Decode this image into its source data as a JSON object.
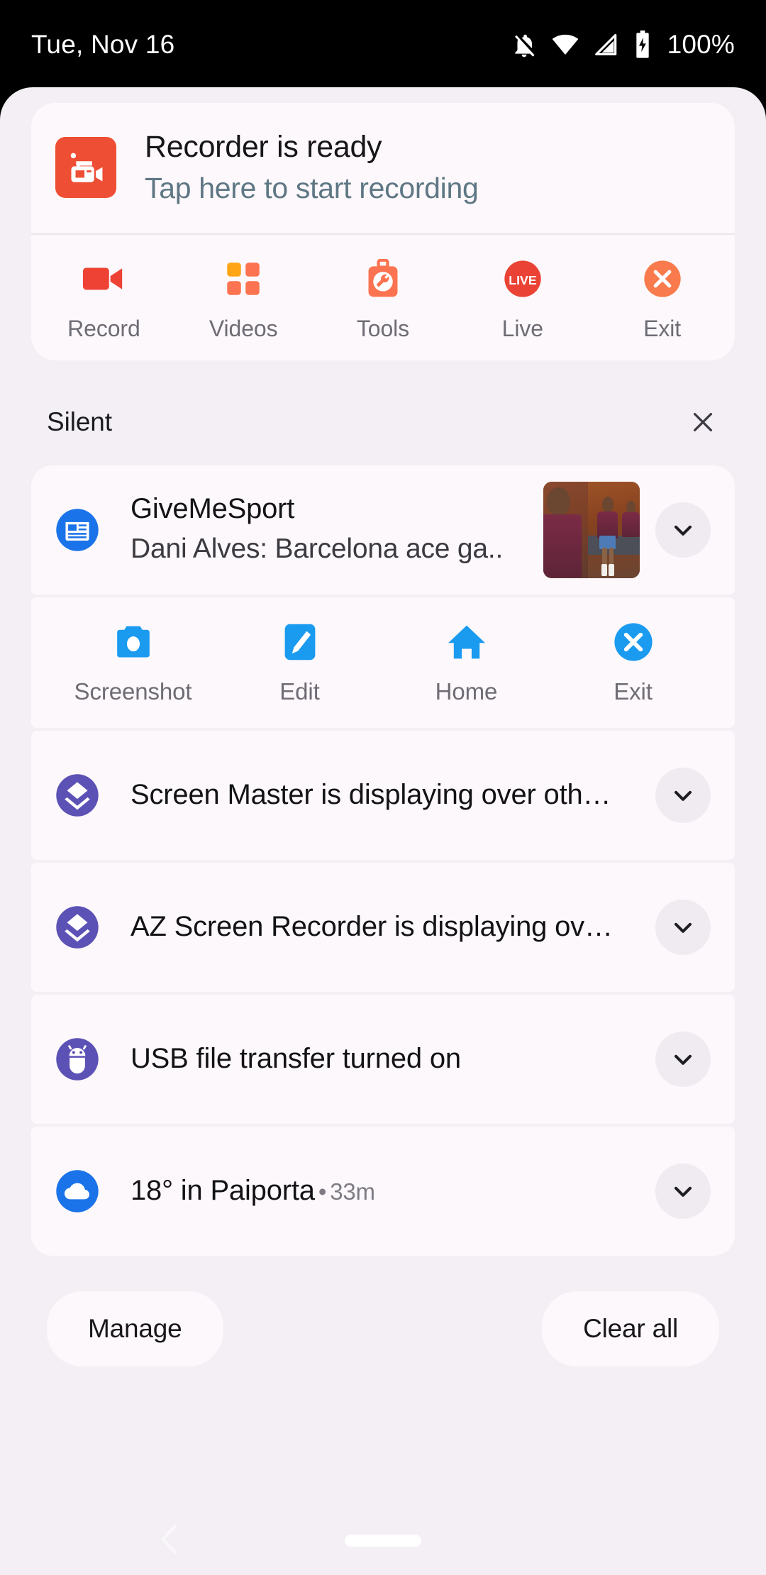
{
  "status_bar": {
    "date": "Tue, Nov 16",
    "battery_percent": "100%",
    "icons": [
      "notifications-off-icon",
      "wifi-icon",
      "cell-signal-icon",
      "battery-charging-icon"
    ]
  },
  "recorder_notification": {
    "app_icon": "az-screen-recorder-icon",
    "title": "Recorder is ready",
    "subtitle": "Tap here to start recording",
    "actions": [
      {
        "label": "Record",
        "icon": "camcorder-icon",
        "color": "#EE4234"
      },
      {
        "label": "Videos",
        "icon": "grid-squares-icon",
        "color": "#FB7350"
      },
      {
        "label": "Tools",
        "icon": "toolbox-wrench-icon",
        "color": "#FB7350"
      },
      {
        "label": "Live",
        "icon": "live-badge-icon",
        "color": "#EA4335"
      },
      {
        "label": "Exit",
        "icon": "close-circle-icon",
        "color": "#F97A4D"
      }
    ]
  },
  "silent_section": {
    "label": "Silent",
    "close_icon": "close-icon"
  },
  "notifications": [
    {
      "app": "GiveMeSport",
      "title": "GiveMeSport",
      "text": "Dani Alves: Barcelona ace ga..",
      "icon": "news-paper-icon",
      "icon_color": "#1A73E8",
      "has_thumbnail": true,
      "expand_icon": "chevron-down-icon"
    },
    {
      "text": "Screen Master is displaying over oth…",
      "icon": "layers-icon",
      "icon_color": "#5C51B5",
      "expand_icon": "chevron-down-icon"
    },
    {
      "text": "AZ Screen Recorder is displaying ov…",
      "icon": "layers-icon",
      "icon_color": "#5C51B5",
      "expand_icon": "chevron-down-icon"
    },
    {
      "text": "USB file transfer turned on",
      "icon": "android-usb-icon",
      "icon_color": "#5C51B5",
      "expand_icon": "chevron-down-icon"
    },
    {
      "text": "18° in Paiporta",
      "separator": "•",
      "time": "33m",
      "icon": "cloud-icon",
      "icon_color": "#1A73E8",
      "expand_icon": "chevron-down-icon"
    }
  ],
  "screen_master_actions": [
    {
      "label": "Screenshot",
      "icon": "camera-icon"
    },
    {
      "label": "Edit",
      "icon": "pencil-icon"
    },
    {
      "label": "Home",
      "icon": "home-icon"
    },
    {
      "label": "Exit",
      "icon": "close-circle-icon"
    }
  ],
  "footer": {
    "manage_label": "Manage",
    "clear_all_label": "Clear all"
  },
  "nav_bar": {
    "back_icon": "back-chevron-icon",
    "home_pill": "home-pill-handle"
  },
  "colors": {
    "shade_background": "#F3EFF4",
    "card_background": "#FDF8FB",
    "accent_orange": "#EE4E34",
    "accent_blue": "#1A9BF0",
    "accent_purple": "#5C51B5"
  }
}
